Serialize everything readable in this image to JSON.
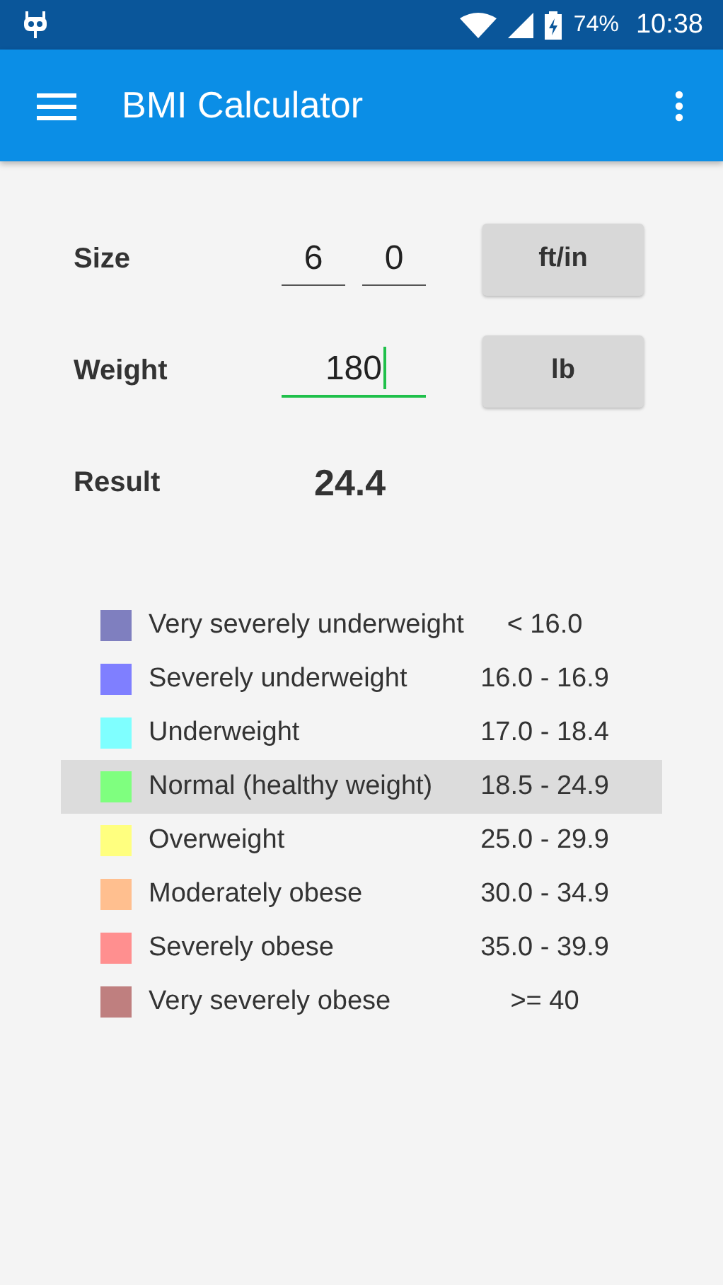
{
  "status_bar": {
    "battery": "74%",
    "time": "10:38"
  },
  "app_bar": {
    "title": "BMI Calculator"
  },
  "form": {
    "rows": [
      {
        "kind": "size",
        "label": "Size",
        "fields": [
          {
            "value": "6",
            "focused": false
          },
          {
            "value": "0",
            "focused": false
          }
        ],
        "unit": "ft/in"
      },
      {
        "kind": "weight",
        "label": "Weight",
        "fields": [
          {
            "value": "180",
            "focused": true
          }
        ],
        "unit": "lb"
      },
      {
        "kind": "result",
        "label": "Result",
        "result": "24.4"
      }
    ]
  },
  "categories": [
    {
      "name": "Very severely underweight",
      "range": "< 16.0",
      "color": "#7f7fbf",
      "selected": false
    },
    {
      "name": "Severely underweight",
      "range": "16.0 - 16.9",
      "color": "#7f7fff",
      "selected": false
    },
    {
      "name": "Underweight",
      "range": "17.0 - 18.4",
      "color": "#7fffff",
      "selected": false
    },
    {
      "name": "Normal (healthy weight)",
      "range": "18.5 - 24.9",
      "color": "#7fff7f",
      "selected": true
    },
    {
      "name": "Overweight",
      "range": "25.0 - 29.9",
      "color": "#ffff7f",
      "selected": false
    },
    {
      "name": "Moderately obese",
      "range": "30.0 - 34.9",
      "color": "#ffbf8f",
      "selected": false
    },
    {
      "name": "Severely obese",
      "range": "35.0 - 39.9",
      "color": "#ff8f8f",
      "selected": false
    },
    {
      "name": "Very severely obese",
      "range": ">= 40",
      "color": "#bf7f7f",
      "selected": false
    }
  ]
}
